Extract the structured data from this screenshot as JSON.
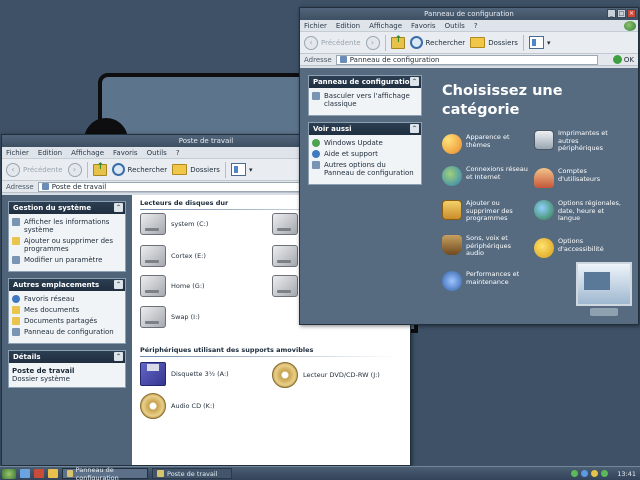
{
  "desktop": {},
  "mycomputer": {
    "title": "Poste de travail",
    "menu": [
      "Fichier",
      "Edition",
      "Affichage",
      "Favoris",
      "Outils",
      "?"
    ],
    "toolbar": {
      "back": "Précédente",
      "search": "Rechercher",
      "folders": "Dossiers"
    },
    "address": {
      "label": "Adresse",
      "value": "Poste de travail"
    },
    "tasks": {
      "title": "Gestion du système",
      "items": [
        "Afficher les informations système",
        "Ajouter ou supprimer des programmes",
        "Modifier un paramètre"
      ]
    },
    "places": {
      "title": "Autres emplacements",
      "items": [
        "Favoris réseau",
        "Mes documents",
        "Documents partagés",
        "Panneau de configuration"
      ]
    },
    "details": {
      "title": "Détails",
      "name": "Poste de travail",
      "type": "Dossier système"
    },
    "hdd_section": "Lecteurs de disques dur",
    "drives": [
      "system (C:)",
      "Cortex (E:)",
      "Home (G:)",
      "Swap (I:)"
    ],
    "removable_section": "Périphériques utilisant des supports amovibles",
    "removable": [
      "Disquette 3½ (A:)",
      "Lecteur DVD/CD-RW (J:)",
      "Audio CD (K:)"
    ]
  },
  "control": {
    "title": "Panneau de configuration",
    "menu": [
      "Fichier",
      "Edition",
      "Affichage",
      "Favoris",
      "Outils",
      "?"
    ],
    "toolbar": {
      "back": "Précédente",
      "search": "Rechercher",
      "folders": "Dossiers"
    },
    "address": {
      "label": "Adresse",
      "value": "Panneau de configuration",
      "go": "OK"
    },
    "side_panel": {
      "title": "Panneau de configuration",
      "switch": "Basculer vers l'affichage classique"
    },
    "see_also": {
      "title": "Voir aussi",
      "items": [
        "Windows Update",
        "Aide et support",
        "Autres options du Panneau de configuration"
      ]
    },
    "heading": "Choisissez une catégorie",
    "categories": [
      "Apparence et thèmes",
      "Imprimantes et autres périphériques",
      "Connexions réseau et Internet",
      "Comptes d'utilisateurs",
      "Ajouter ou supprimer des programmes",
      "Options régionales, date, heure et langue",
      "Sons, voix et périphériques audio",
      "Options d'accessibilité",
      "Performances et maintenance"
    ]
  },
  "taskbar": {
    "tasks": [
      "Panneau de configuration",
      "Poste de travail"
    ],
    "clock": "13:41"
  }
}
